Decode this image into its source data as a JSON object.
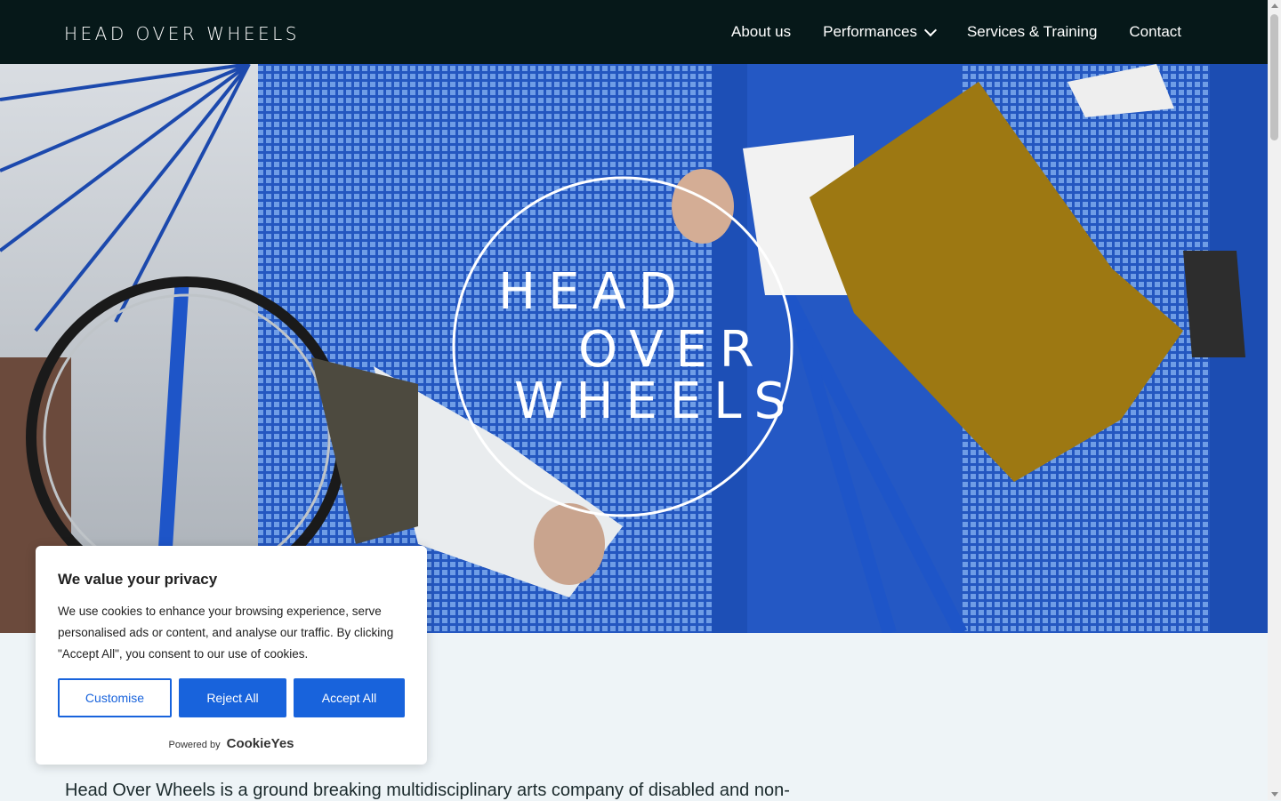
{
  "header": {
    "logo": "HEAD OVER WHEELS",
    "nav": [
      {
        "label": "About us"
      },
      {
        "label": "Performances"
      },
      {
        "label": "Services & Training"
      },
      {
        "label": "Contact"
      }
    ]
  },
  "hero": {
    "logo_lines": [
      "HEAD",
      "OVER",
      "WHEELS"
    ]
  },
  "intro": {
    "text": "Head Over Wheels is a ground breaking multidisciplinary arts company of disabled and non-"
  },
  "cookie_banner": {
    "title": "We value your privacy",
    "body": "We use cookies to enhance your browsing experience, serve personalised ads or content, and analyse our traffic. By clicking \"Accept All\", you consent to our use of cookies.",
    "customise_label": "Customise",
    "reject_label": "Reject All",
    "accept_label": "Accept All",
    "powered_by": "Powered by",
    "brand": "CookieYes"
  },
  "colors": {
    "header_bg": "#061819",
    "accent": "#1863dc",
    "page_bg": "#eef4f7"
  }
}
